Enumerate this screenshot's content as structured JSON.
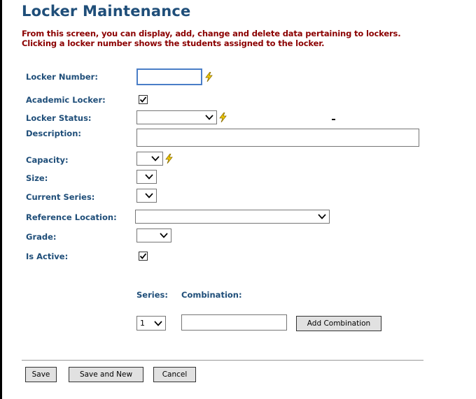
{
  "page": {
    "title": "Locker Maintenance",
    "intro_line1": "From this screen, you can display, add, change and delete data pertaining to lockers.",
    "intro_line2": "Clicking a locker number shows the students assigned to the locker."
  },
  "form": {
    "locker_number": {
      "label": "Locker Number:",
      "value": "",
      "required_icon": "lightning-bolt-icon"
    },
    "academic_locker": {
      "label": "Academic Locker:",
      "checked": true
    },
    "locker_status": {
      "label": "Locker Status:",
      "selected": "",
      "required_icon": "lightning-bolt-icon"
    },
    "description": {
      "label": "Description:",
      "value": ""
    },
    "capacity": {
      "label": "Capacity:",
      "selected": "",
      "required_icon": "lightning-bolt-icon"
    },
    "size": {
      "label": "Size:",
      "selected": ""
    },
    "current_series": {
      "label": "Current Series:",
      "selected": ""
    },
    "reference_location": {
      "label": "Reference Location:",
      "selected": ""
    },
    "grade": {
      "label": "Grade:",
      "selected": ""
    },
    "is_active": {
      "label": "Is Active:",
      "checked": true
    }
  },
  "combination": {
    "series_header": "Series:",
    "combination_header": "Combination:",
    "series_selected": "1",
    "combination_value": "",
    "add_button": "Add Combination"
  },
  "actions": {
    "save": "Save",
    "save_and_new": "Save and New",
    "cancel": "Cancel"
  },
  "colors": {
    "label": "#1f4e79",
    "intro": "#8b0000",
    "bolt": "#f0c800"
  }
}
